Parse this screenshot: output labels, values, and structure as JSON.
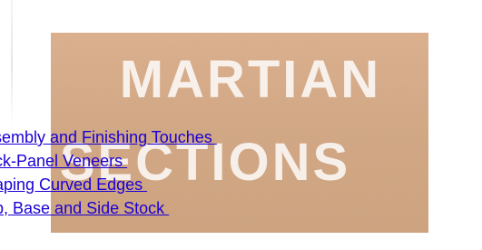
{
  "banner": {
    "logo_line1": "MARTIAN",
    "logo_line2": "SECTIONS",
    "logo_color": "#ffffff",
    "background_color": "#c99a73"
  },
  "nav": {
    "links": [
      {
        "label": "ssembly and Finishing Touches "
      },
      {
        "label": "ack-Panel Veneers "
      },
      {
        "label": "haping Curved Edges "
      },
      {
        "label": "op, Base and Side Stock "
      }
    ],
    "link_color": "#1b00d4"
  }
}
